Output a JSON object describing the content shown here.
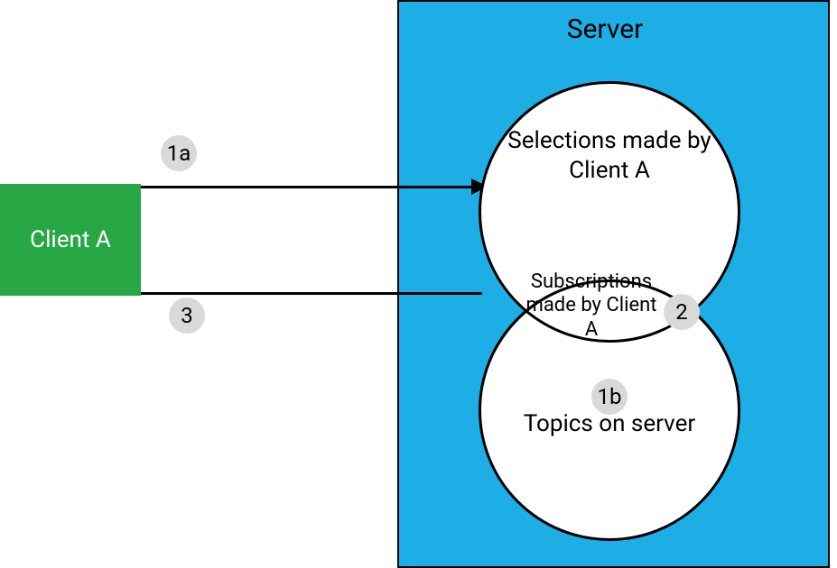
{
  "server": {
    "title": "Server",
    "circle_top_label": "Selections made by Client A",
    "lens_label": "Subscriptions made by Client A",
    "circle_bottom_label": "Topics on server"
  },
  "client": {
    "label": "Client A"
  },
  "badges": {
    "b1a": "1a",
    "b1b": "1b",
    "b2": "2",
    "b3": "3"
  },
  "colors": {
    "server_bg": "#1eaee6",
    "client_bg": "#28a745",
    "badge_bg": "#d9d9d9"
  }
}
